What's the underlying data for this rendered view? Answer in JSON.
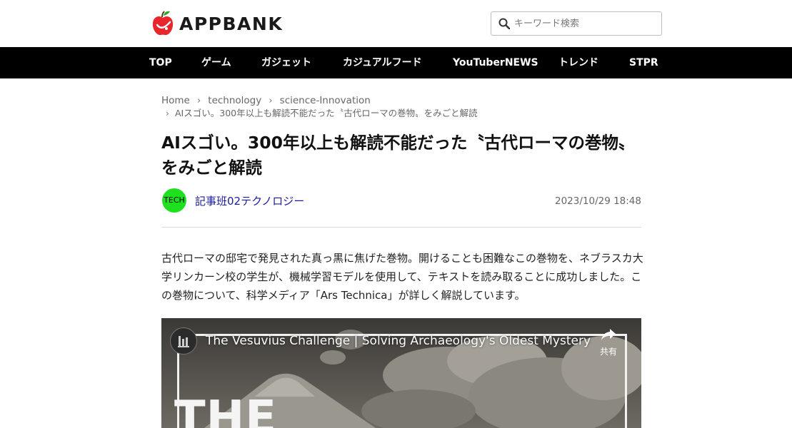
{
  "header": {
    "logo_text": "APPBANK",
    "search_placeholder": "キーワード検索"
  },
  "nav": {
    "items": [
      {
        "label": "TOP"
      },
      {
        "label": "ゲーム"
      },
      {
        "label": "ガジェット"
      },
      {
        "label": "カジュアルフード"
      },
      {
        "label": "YouTuberNEWS"
      },
      {
        "label": "トレンド"
      },
      {
        "label": "STPR"
      }
    ]
  },
  "breadcrumb": {
    "sep": "›",
    "items": [
      {
        "label": "Home"
      },
      {
        "label": "technology"
      },
      {
        "label": "science-Innovation"
      },
      {
        "label": "AIスゴい。300年以上も解読不能だった〝古代ローマの巻物〟をみごと解読"
      }
    ]
  },
  "article": {
    "title": "AIスゴい。300年以上も解読不能だった〝古代ローマの巻物〟をみごと解読",
    "author_badge": "TECH",
    "author_name": "記事班02テクノロジー",
    "date": "2023/10/29 18:48",
    "lead": "古代ローマの邸宅で発見された真っ黒に焦げた巻物。開けることも困難なこの巻物を、ネブラスカ大学リンカーン校の学生が、機械学習モデルを使用して、テキストを読み取ることに成功しました。この巻物について、科学メディア「Ars Technica」が詳しく解説しています。"
  },
  "video": {
    "title": "The Vesuvius Challenge | Solving Archaeology's Oldest Mystery",
    "share_label": "共有",
    "overlay_text": "THE",
    "icons": {
      "share": "share-icon",
      "channel": "channel-avatar-icon"
    }
  },
  "colors": {
    "nav_bg": "#000000",
    "author_badge": "#1fe01f",
    "author_link": "#1a1a9e",
    "logo_apple": "#e8262b"
  }
}
